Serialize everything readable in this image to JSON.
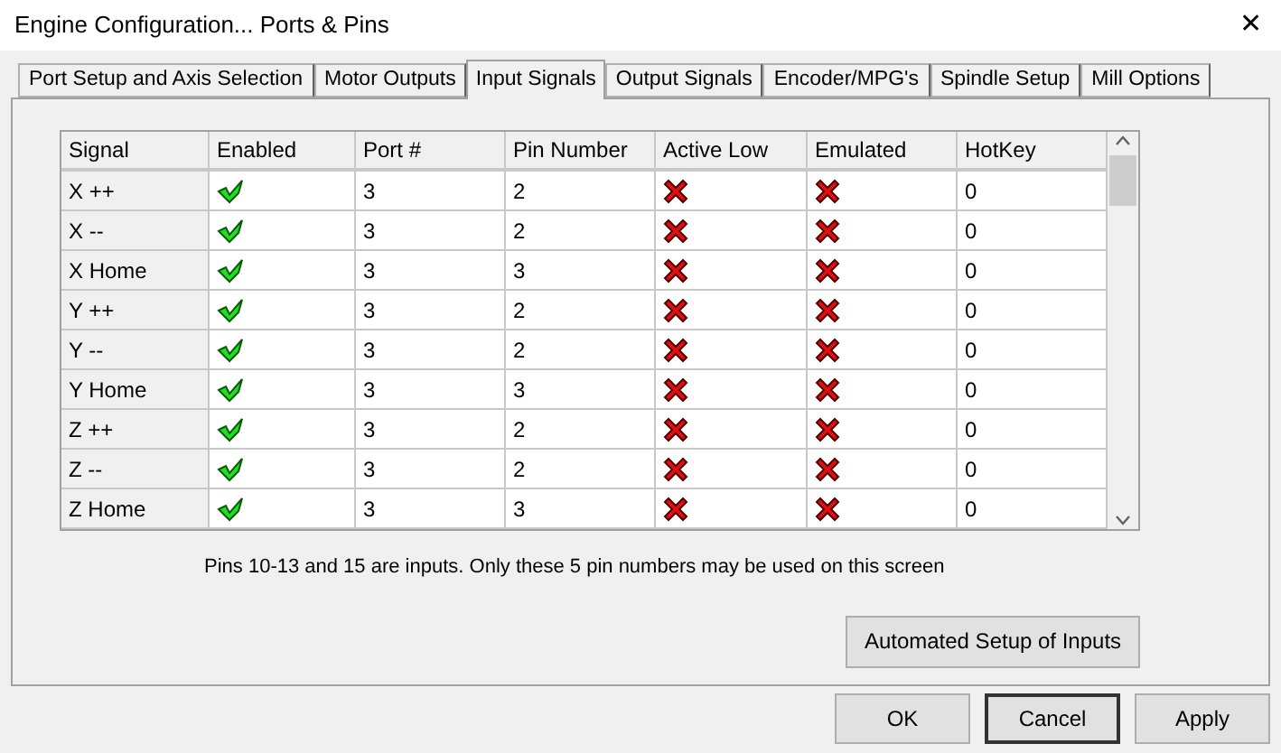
{
  "window": {
    "title": "Engine Configuration... Ports & Pins",
    "close": "✕"
  },
  "tabs": [
    {
      "label": "Port Setup and Axis Selection",
      "selected": false
    },
    {
      "label": "Motor Outputs",
      "selected": false
    },
    {
      "label": "Input Signals",
      "selected": true
    },
    {
      "label": "Output Signals",
      "selected": false
    },
    {
      "label": "Encoder/MPG's",
      "selected": false
    },
    {
      "label": "Spindle Setup",
      "selected": false
    },
    {
      "label": "Mill Options",
      "selected": false
    }
  ],
  "table": {
    "columns": [
      "Signal",
      "Enabled",
      "Port #",
      "Pin Number",
      "Active Low",
      "Emulated",
      "HotKey"
    ],
    "rows": [
      {
        "signal": "X ++",
        "enabled": true,
        "port": "3",
        "pin": "2",
        "active_low": false,
        "emulated": false,
        "hotkey": "0"
      },
      {
        "signal": "X --",
        "enabled": true,
        "port": "3",
        "pin": "2",
        "active_low": false,
        "emulated": false,
        "hotkey": "0"
      },
      {
        "signal": "X Home",
        "enabled": true,
        "port": "3",
        "pin": "3",
        "active_low": false,
        "emulated": false,
        "hotkey": "0"
      },
      {
        "signal": "Y ++",
        "enabled": true,
        "port": "3",
        "pin": "2",
        "active_low": false,
        "emulated": false,
        "hotkey": "0"
      },
      {
        "signal": "Y --",
        "enabled": true,
        "port": "3",
        "pin": "2",
        "active_low": false,
        "emulated": false,
        "hotkey": "0"
      },
      {
        "signal": "Y Home",
        "enabled": true,
        "port": "3",
        "pin": "3",
        "active_low": false,
        "emulated": false,
        "hotkey": "0"
      },
      {
        "signal": "Z ++",
        "enabled": true,
        "port": "3",
        "pin": "2",
        "active_low": false,
        "emulated": false,
        "hotkey": "0"
      },
      {
        "signal": "Z --",
        "enabled": true,
        "port": "3",
        "pin": "2",
        "active_low": false,
        "emulated": false,
        "hotkey": "0"
      },
      {
        "signal": "Z Home",
        "enabled": true,
        "port": "3",
        "pin": "3",
        "active_low": false,
        "emulated": false,
        "hotkey": "0"
      }
    ]
  },
  "note": "Pins 10-13 and 15 are inputs. Only these 5 pin numbers may be used on this screen",
  "automated_button": "Automated Setup of Inputs",
  "buttons": [
    {
      "label": "OK",
      "default": false
    },
    {
      "label": "Cancel",
      "default": true
    },
    {
      "label": "Apply",
      "default": false
    }
  ]
}
